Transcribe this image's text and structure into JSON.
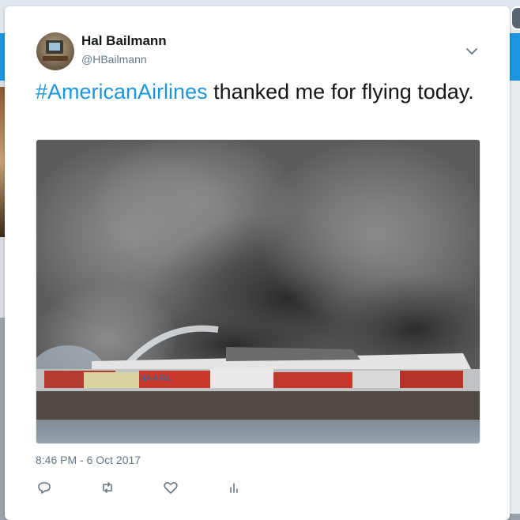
{
  "tweet": {
    "author_name": "Hal Bailmann",
    "author_handle": "@HBailmann",
    "text_hashtag": "#AmericanAirlines",
    "text_body": " thanked me for flying today.",
    "timestamp": "8:46 PM - 6 Oct 2017",
    "media_description_visible": "NA AIRL"
  },
  "icons": {
    "menu": "chevron-down-icon",
    "reply": "reply-icon",
    "retweet": "retweet-icon",
    "like": "heart-icon",
    "analytics": "analytics-icon"
  },
  "colors": {
    "link": "#1b95e0",
    "text": "#14171a",
    "secondary": "#657786"
  }
}
